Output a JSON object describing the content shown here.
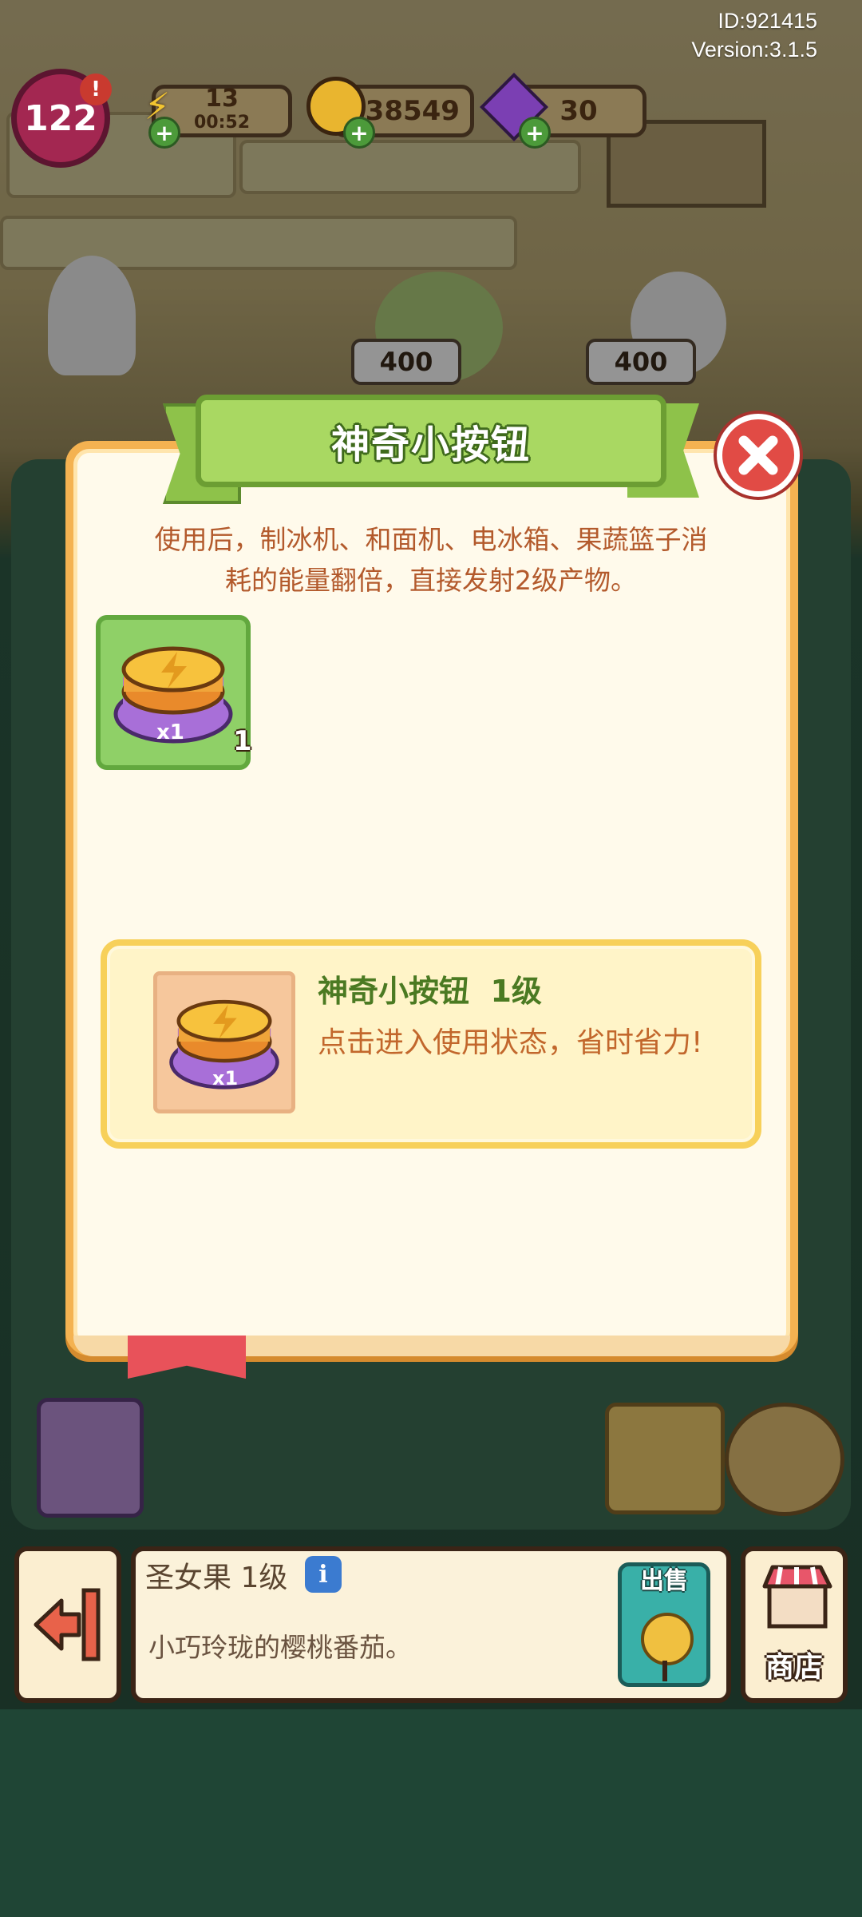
{
  "hud": {
    "id_text": "ID:921415",
    "version_text": "Version:3.1.5",
    "level": "122",
    "level_badge": "!",
    "energy": "13",
    "energy_timer": "00:52",
    "coins": "138549",
    "gems": "30",
    "energy_icon": "lightning-icon",
    "coin_icon": "coin-icon",
    "gem_icon": "gem-icon"
  },
  "scene": {
    "price_tags": [
      "400",
      "400"
    ]
  },
  "popup": {
    "title": "神奇小按钮",
    "description_line1": "使用后，制冰机、和面机、电冰箱、果蔬篮子消",
    "description_line2": "耗的能量翻倍，直接发射2级产物。",
    "slot_item_icon": "energy-button-icon",
    "slot_item_multiplier": "x1",
    "slot_count": "1",
    "info_title": "神奇小按钮  1级",
    "info_desc": "点击进入使用状态，省时省力!",
    "info_item_multiplier": "x1",
    "close_icon": "close-icon"
  },
  "bottom": {
    "item_name": "圣女果 1级",
    "info_icon": "i",
    "item_desc": "小巧玲珑的樱桃番茄。",
    "sell_label": "出售",
    "shop_label": "商店",
    "back_icon": "exit-icon"
  },
  "colors": {
    "popup_border": "#f4b251",
    "popup_bg": "#fffaeb",
    "title_banner": "#a9d862",
    "close_button": "#e14b45",
    "desc_text": "#b35a2c",
    "info_title": "#4b7a22"
  }
}
